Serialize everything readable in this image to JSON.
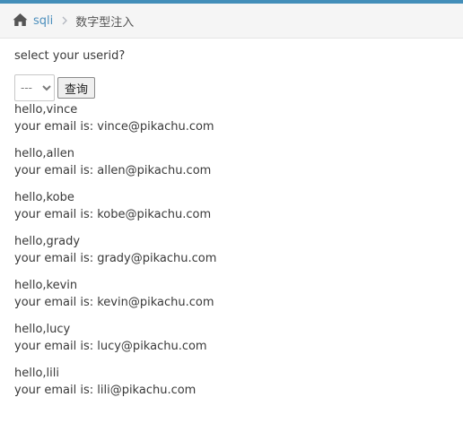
{
  "breadcrumb": {
    "home_label": "sqli",
    "current": "数字型注入"
  },
  "form": {
    "question": "select your userid?",
    "select_value": "---",
    "submit_label": "查询"
  },
  "results": [
    {
      "hello": "hello,vince",
      "email": "your email is: vince@pikachu.com"
    },
    {
      "hello": "hello,allen",
      "email": "your email is: allen@pikachu.com"
    },
    {
      "hello": "hello,kobe",
      "email": "your email is: kobe@pikachu.com"
    },
    {
      "hello": "hello,grady",
      "email": "your email is: grady@pikachu.com"
    },
    {
      "hello": "hello,kevin",
      "email": "your email is: kevin@pikachu.com"
    },
    {
      "hello": "hello,lucy",
      "email": "your email is: lucy@pikachu.com"
    },
    {
      "hello": "hello,lili",
      "email": "your email is: lili@pikachu.com"
    }
  ],
  "colors": {
    "top_bar": "#438eb9",
    "link": "#4c8fbd",
    "breadcrumb_bg": "#f5f5f5"
  },
  "icons": {
    "home": "home-icon",
    "separator": "chevron-right-icon"
  }
}
